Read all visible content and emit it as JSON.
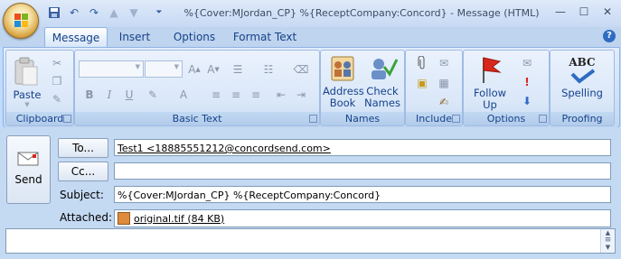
{
  "window": {
    "title": "%{Cover:MJordan_CP} %{ReceptCompany:Concord} - Message (HTML)",
    "minimize_glyph": "—",
    "maximize_glyph": "☐",
    "close_glyph": "✕"
  },
  "tabs": [
    "Message",
    "Insert",
    "Options",
    "Format Text"
  ],
  "help_glyph": "?",
  "groups": {
    "clipboard": {
      "label": "Clipboard",
      "paste_label": "Paste"
    },
    "basic_text": {
      "label": "Basic Text"
    },
    "names": {
      "label": "Names",
      "address_book": "Address Book",
      "check_names": "Check Names"
    },
    "include": {
      "label": "Include"
    },
    "options": {
      "label": "Options",
      "follow_up": "Follow Up"
    },
    "proofing": {
      "label": "Proofing",
      "spelling": "Spelling",
      "abc": "ABC"
    }
  },
  "format_buttons": {
    "bold": "B",
    "italic": "I",
    "underline": "U"
  },
  "compose": {
    "send_label": "Send",
    "to_button": "To...",
    "cc_button": "Cc...",
    "subject_label": "Subject:",
    "attached_label": "Attached:",
    "to_value": "Test1 <18885551212@concordsend.com>",
    "cc_value": "",
    "subject_value": "%{Cover:MJordan_CP} %{ReceptCompany:Concord}",
    "attachment": "original.tif (84 KB)"
  },
  "colors": {
    "accent": "#15428b",
    "ribbon_bg": "#d2e1f5",
    "follow_up_flag": "#d9261c"
  }
}
